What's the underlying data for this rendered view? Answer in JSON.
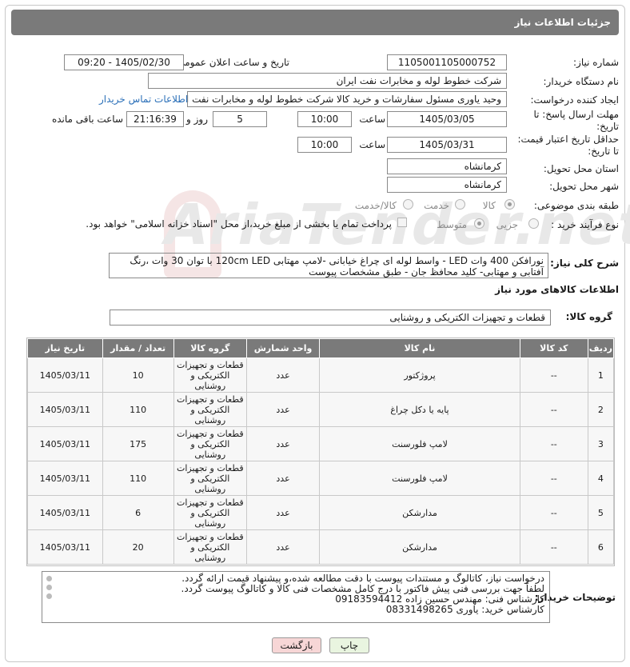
{
  "header": {
    "title": "جزئیات اطلاعات نیاز"
  },
  "form": {
    "need_number_label": "شماره نیاز:",
    "need_number": "1105001105000752",
    "announce_label": "تاریخ و ساعت اعلان عمومی:",
    "announce_value": "1405/02/30 - 09:20",
    "buyer_org_label": "نام دستگاه خریدار:",
    "buyer_org": "شرکت خطوط لوله و مخابرات نفت ایران",
    "creator_label": "ایجاد کننده درخواست:",
    "creator": "وحید یاوری مسئول سفارشات و خرید کالا  شرکت خطوط لوله و مخابرات نفت ایران",
    "buyer_contact_link": "اطلاعات تماس خریدار",
    "deadline_label_1": "مهلت ارسال پاسخ: تا",
    "deadline_label_2": "تاریخ:",
    "deadline_date": "1405/03/05",
    "time_label": "ساعت",
    "deadline_time": "10:00",
    "days_value": "5",
    "days_label": "روز و",
    "remaining_time": "21:16:39",
    "remaining_label": "ساعت باقی مانده",
    "validity_label_1": "حداقل تاریخ اعتبار قیمت:",
    "validity_label_2": "تا تاریخ:",
    "validity_date": "1405/03/31",
    "validity_time": "10:00",
    "province_label": "استان محل تحویل:",
    "province": "کرمانشاه",
    "city_label": "شهر محل تحویل:",
    "city": "کرمانشاه",
    "category_label": "طبقه بندی موضوعی:",
    "category_options": [
      "کالا",
      "خدمت",
      "کالا/خدمت"
    ],
    "purchase_type_label": "نوع فرآیند خرید :",
    "purchase_options": [
      "جزیی",
      "متوسط"
    ],
    "payment_note": "پرداخت تمام یا بخشی از مبلغ خرید،از محل \"اسناد خزانه اسلامی\" خواهد بود."
  },
  "description": {
    "label": "شرح کلی نیاز:",
    "text": "نورافکن 400 وات LED - واسط لوله ای چراغ خیابانی -لامپ مهتابی 120cm LED با توان 30 وات ،رنگ آفتابی و مهتابی- کلید محافظ جان - طبق مشخصات پیوست"
  },
  "goods": {
    "section_title": "اطلاعات کالاهای مورد نیاز",
    "group_label": "گروه کالا:",
    "group_value": "قطعات و تجهیزات الکتریکی و روشنایی",
    "columns": [
      "ردیف",
      "کد کالا",
      "نام کالا",
      "واحد شمارش",
      "گروه کالا",
      "تعداد / مقدار",
      "تاریخ نیاز"
    ],
    "rows": [
      {
        "idx": "1",
        "code": "--",
        "name": "پروژکتور",
        "unit": "عدد",
        "group": "قطعات و تجهیزات الکتریکی و روشنایی",
        "qty": "10",
        "date": "1405/03/11"
      },
      {
        "idx": "2",
        "code": "--",
        "name": "پایه یا دکل چراغ",
        "unit": "عدد",
        "group": "قطعات و تجهیزات الکتریکی و روشنایی",
        "qty": "110",
        "date": "1405/03/11"
      },
      {
        "idx": "3",
        "code": "--",
        "name": "لامپ فلورسنت",
        "unit": "عدد",
        "group": "قطعات و تجهیزات الکتریکی و روشنایی",
        "qty": "175",
        "date": "1405/03/11"
      },
      {
        "idx": "4",
        "code": "--",
        "name": "لامپ فلورسنت",
        "unit": "عدد",
        "group": "قطعات و تجهیزات الکتریکی و روشنایی",
        "qty": "110",
        "date": "1405/03/11"
      },
      {
        "idx": "5",
        "code": "--",
        "name": "مدارشکن",
        "unit": "عدد",
        "group": "قطعات و تجهیزات الکتریکی و روشنایی",
        "qty": "6",
        "date": "1405/03/11"
      },
      {
        "idx": "6",
        "code": "--",
        "name": "مدارشکن",
        "unit": "عدد",
        "group": "قطعات و تجهیزات الکتریکی و روشنایی",
        "qty": "20",
        "date": "1405/03/11"
      }
    ]
  },
  "buyer_notes": {
    "label": "توضیحات خریدار:",
    "lines": [
      "درخواست نیاز، کاتالوگ و مستندات پیوست با دقت مطالعه شده،و پیشنهاد قیمت ارائه گردد.",
      "لطفاً جهت بررسی فنی  پیش فاکتور با درج کامل مشخصات فنی کالا و کاتالوگ پیوست گردد.",
      "کارشناس فنی: مهندس حسین زاده 09183594412",
      "کارشناس خرید: یاوری 08331498265"
    ]
  },
  "buttons": {
    "print": "چاپ",
    "back": "بازگشت"
  },
  "watermark": "AriaTender.net",
  "colors": {
    "header_bg": "#7a7a7a",
    "link": "#2a6fb8",
    "back_button_bg": "#f7d6d6",
    "print_button_bg": "#e9f5e0"
  }
}
